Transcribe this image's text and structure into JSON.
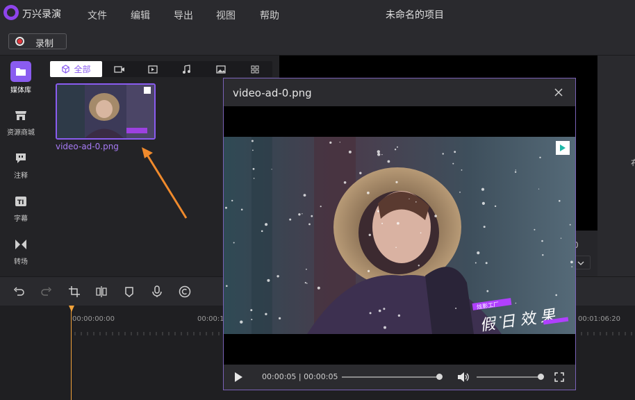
{
  "app": {
    "name": "万兴录演",
    "project_title": "未命名的项目"
  },
  "menu": [
    "文件",
    "编辑",
    "导出",
    "视图",
    "帮助"
  ],
  "toolbar": {
    "record_label": "录制"
  },
  "sidenav": [
    {
      "label": "媒体库",
      "icon": "folder-icon",
      "active": true
    },
    {
      "label": "资源商城",
      "icon": "store-icon",
      "active": false
    },
    {
      "label": "注释",
      "icon": "annotation-icon",
      "active": false
    },
    {
      "label": "字幕",
      "icon": "caption-icon",
      "active": false
    },
    {
      "label": "转场",
      "icon": "transition-icon",
      "active": false
    }
  ],
  "media": {
    "filter_all_label": "全部",
    "filter_icons": [
      "video-icon",
      "play-icon",
      "music-icon",
      "image-icon",
      "grid-icon"
    ],
    "items": [
      {
        "name": "video-ad-0.png"
      }
    ]
  },
  "timeline": {
    "tick_labels": [
      "00:00:00:00",
      "00:00:1",
      "00:01:06:20"
    ],
    "tools": [
      "undo-icon",
      "redo-icon",
      "crop-icon",
      "split-icon",
      "marker-icon",
      "mic-icon",
      "copyright-icon"
    ]
  },
  "preview_side": {
    "frame_char": "0"
  },
  "right_panel": {
    "char": "布"
  },
  "modal": {
    "title": "video-ad-0.png",
    "overlay_small": "炫影工厂",
    "overlay_text": "假 日 效 果",
    "time": "00:00:05 | 00:00:05",
    "progress": 1.0,
    "volume": 1.0
  },
  "colors": {
    "accent": "#8a5cf0",
    "playhead": "#f2a23a",
    "record": "#e0343a"
  }
}
